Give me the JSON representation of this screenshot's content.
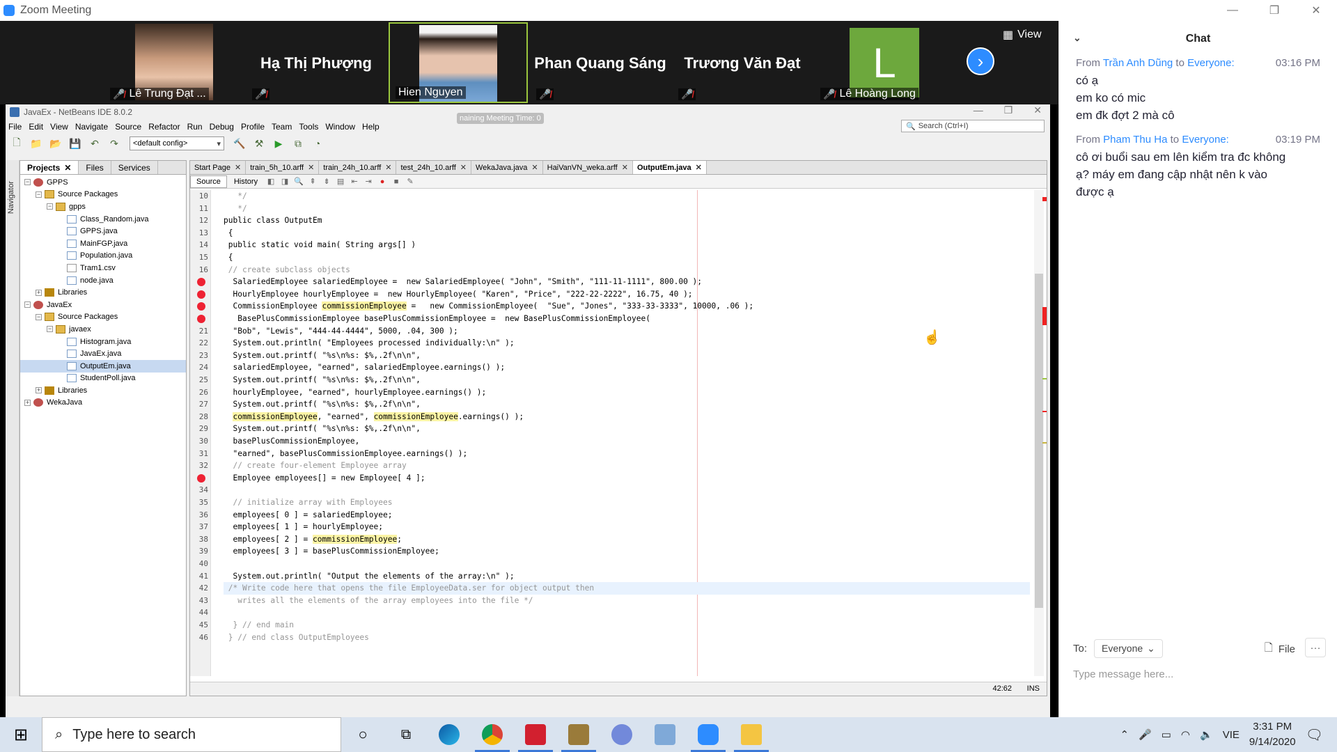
{
  "zoom": {
    "window_title": "Zoom Meeting",
    "view_label": "View",
    "participants": [
      {
        "name": "Lê Trung Đạt ...",
        "muted": true,
        "has_video": true
      },
      {
        "name": "Hạ Thị Phượng",
        "muted": true,
        "has_video": false
      },
      {
        "name": "Hien Nguyen",
        "muted": false,
        "has_video": true,
        "active_speaker": true
      },
      {
        "name": "Phan Quang Sáng",
        "muted": true,
        "has_video": false
      },
      {
        "name": "Trương Văn Đạt",
        "muted": true,
        "has_video": false
      },
      {
        "name": "Lê Hoàng Long",
        "muted": true,
        "has_video": false,
        "avatar_letter": "L"
      }
    ],
    "meeting_time_label": "naining Meeting Time: 0"
  },
  "netbeans": {
    "title": "JavaEx - NetBeans IDE 8.0.2",
    "menu": [
      "File",
      "Edit",
      "View",
      "Navigate",
      "Source",
      "Refactor",
      "Run",
      "Debug",
      "Profile",
      "Team",
      "Tools",
      "Window",
      "Help"
    ],
    "config": "<default config>",
    "search_placeholder": "Search (Ctrl+I)",
    "navigator_label": "Navigator",
    "panel_tabs": [
      "Projects",
      "Files",
      "Services"
    ],
    "tree": [
      {
        "label": "GPPS",
        "depth": 0,
        "icon": "proj",
        "exp": "−"
      },
      {
        "label": "Source Packages",
        "depth": 1,
        "icon": "pkg",
        "exp": "−"
      },
      {
        "label": "gpps",
        "depth": 2,
        "icon": "pkg",
        "exp": "−"
      },
      {
        "label": "Class_Random.java",
        "depth": 3,
        "icon": "jv"
      },
      {
        "label": "GPPS.java",
        "depth": 3,
        "icon": "jv"
      },
      {
        "label": "MainFGP.java",
        "depth": 3,
        "icon": "jv"
      },
      {
        "label": "Population.java",
        "depth": 3,
        "icon": "jv"
      },
      {
        "label": "Tram1.csv",
        "depth": 3,
        "icon": "csv"
      },
      {
        "label": "node.java",
        "depth": 3,
        "icon": "jv"
      },
      {
        "label": "Libraries",
        "depth": 1,
        "icon": "lib",
        "exp": "+"
      },
      {
        "label": "JavaEx",
        "depth": 0,
        "icon": "proj",
        "exp": "−"
      },
      {
        "label": "Source Packages",
        "depth": 1,
        "icon": "pkg",
        "exp": "−"
      },
      {
        "label": "javaex",
        "depth": 2,
        "icon": "pkg",
        "exp": "−"
      },
      {
        "label": "Histogram.java",
        "depth": 3,
        "icon": "jv"
      },
      {
        "label": "JavaEx.java",
        "depth": 3,
        "icon": "jv"
      },
      {
        "label": "OutputEm.java",
        "depth": 3,
        "icon": "jv",
        "selected": true
      },
      {
        "label": "StudentPoll.java",
        "depth": 3,
        "icon": "jv"
      },
      {
        "label": "Libraries",
        "depth": 1,
        "icon": "lib",
        "exp": "+"
      },
      {
        "label": "WekaJava",
        "depth": 0,
        "icon": "proj",
        "exp": "+"
      }
    ],
    "editor_tabs": [
      "Start Page",
      "train_5h_10.arff",
      "train_24h_10.arff",
      "test_24h_10.arff",
      "WekaJava.java",
      "HaiVanVN_weka.arff",
      "OutputEm.java"
    ],
    "active_tab": "OutputEm.java",
    "source_label": "Source",
    "history_label": "History",
    "code": [
      {
        "n": "10",
        "t": "   */",
        "c": "cm"
      },
      {
        "n": "11",
        "t": "   */",
        "c": "cm"
      },
      {
        "n": "12",
        "t": "public class OutputEm"
      },
      {
        "n": "13",
        "t": " {"
      },
      {
        "n": "14",
        "t": " public static void main( String args[] )"
      },
      {
        "n": "15",
        "t": " {"
      },
      {
        "n": "16",
        "t": " // create subclass objects",
        "c": "cm"
      },
      {
        "n": "",
        "t": "  SalariedEmployee salariedEmployee =  new SalariedEmployee( \"John\", \"Smith\", \"111-11-1111\", 800.00 );",
        "err": true
      },
      {
        "n": "",
        "t": "  HourlyEmployee hourlyEmployee =  new HourlyEmployee( \"Karen\", \"Price\", \"222-22-2222\", 16.75, 40 );",
        "err": true
      },
      {
        "n": "",
        "t": "  CommissionEmployee commissionEmployee =   new CommissionEmployee(  \"Sue\", \"Jones\", \"333-33-3333\", 10000, .06 );",
        "err": true
      },
      {
        "n": "",
        "t": "   BasePlusCommissionEmployee basePlusCommissionEmployee =  new BasePlusCommissionEmployee(",
        "err": true
      },
      {
        "n": "21",
        "t": "  \"Bob\", \"Lewis\", \"444-44-4444\", 5000, .04, 300 );"
      },
      {
        "n": "22",
        "t": "  System.out.println( \"Employees processed individually:\\n\" );"
      },
      {
        "n": "23",
        "t": "  System.out.printf( \"%s\\n%s: $%,.2f\\n\\n\","
      },
      {
        "n": "24",
        "t": "  salariedEmployee, \"earned\", salariedEmployee.earnings() );"
      },
      {
        "n": "25",
        "t": "  System.out.printf( \"%s\\n%s: $%,.2f\\n\\n\","
      },
      {
        "n": "26",
        "t": "  hourlyEmployee, \"earned\", hourlyEmployee.earnings() );"
      },
      {
        "n": "27",
        "t": "  System.out.printf( \"%s\\n%s: $%,.2f\\n\\n\","
      },
      {
        "n": "28",
        "t": "  commissionEmployee, \"earned\", commissionEmployee.earnings() );"
      },
      {
        "n": "29",
        "t": "  System.out.printf( \"%s\\n%s: $%,.2f\\n\\n\","
      },
      {
        "n": "30",
        "t": "  basePlusCommissionEmployee,"
      },
      {
        "n": "31",
        "t": "  \"earned\", basePlusCommissionEmployee.earnings() );"
      },
      {
        "n": "32",
        "t": "  // create four-element Employee array",
        "c": "cm"
      },
      {
        "n": "",
        "t": "  Employee employees[] = new Employee[ 4 ];",
        "err": true
      },
      {
        "n": "34",
        "t": ""
      },
      {
        "n": "35",
        "t": "  // initialize array with Employees",
        "c": "cm"
      },
      {
        "n": "36",
        "t": "  employees[ 0 ] = salariedEmployee;"
      },
      {
        "n": "37",
        "t": "  employees[ 1 ] = hourlyEmployee;"
      },
      {
        "n": "38",
        "t": "  employees[ 2 ] = commissionEmployee;"
      },
      {
        "n": "39",
        "t": "  employees[ 3 ] = basePlusCommissionEmployee;"
      },
      {
        "n": "40",
        "t": ""
      },
      {
        "n": "41",
        "t": "  System.out.println( \"Output the elements of the array:\\n\" );"
      },
      {
        "n": "42",
        "t": " /* Write code here that opens the file EmployeeData.ser for object output then",
        "c": "cm",
        "cur": true
      },
      {
        "n": "43",
        "t": "   writes all the elements of the array employees into the file */",
        "c": "cm"
      },
      {
        "n": "44",
        "t": ""
      },
      {
        "n": "45",
        "t": "  } // end main",
        "c": "cm"
      },
      {
        "n": "46",
        "t": " } // end class OutputEmployees",
        "c": "cm"
      }
    ],
    "status_position": "42:62",
    "status_mode": "INS"
  },
  "chat": {
    "title": "Chat",
    "messages": [
      {
        "from_label": "From",
        "sender": "Trần Anh Dũng",
        "to_label": "to",
        "recipient": "Everyone:",
        "time": "03:16 PM",
        "lines": [
          "có ạ",
          "em ko có mic",
          "em đk đợt 2 mà cô"
        ]
      },
      {
        "from_label": "From",
        "sender": "Pham Thu Ha",
        "to_label": "to",
        "recipient": "Everyone:",
        "time": "03:19 PM",
        "lines": [
          "cô ơi buổi sau em lên kiểm tra đc không",
          "ạ? máy em đang cập nhật nên k vào",
          "được ạ"
        ]
      }
    ],
    "to_label": "To:",
    "to_value": "Everyone",
    "file_label": "File",
    "input_placeholder": "Type message here..."
  },
  "taskbar": {
    "search_placeholder": "Type here to search",
    "language": "VIE",
    "time": "3:31 PM",
    "date": "9/14/2020"
  },
  "colors": {
    "zoom_blue": "#2d8cff",
    "error_red": "#e22233",
    "highlight": "#fbf4a5"
  }
}
